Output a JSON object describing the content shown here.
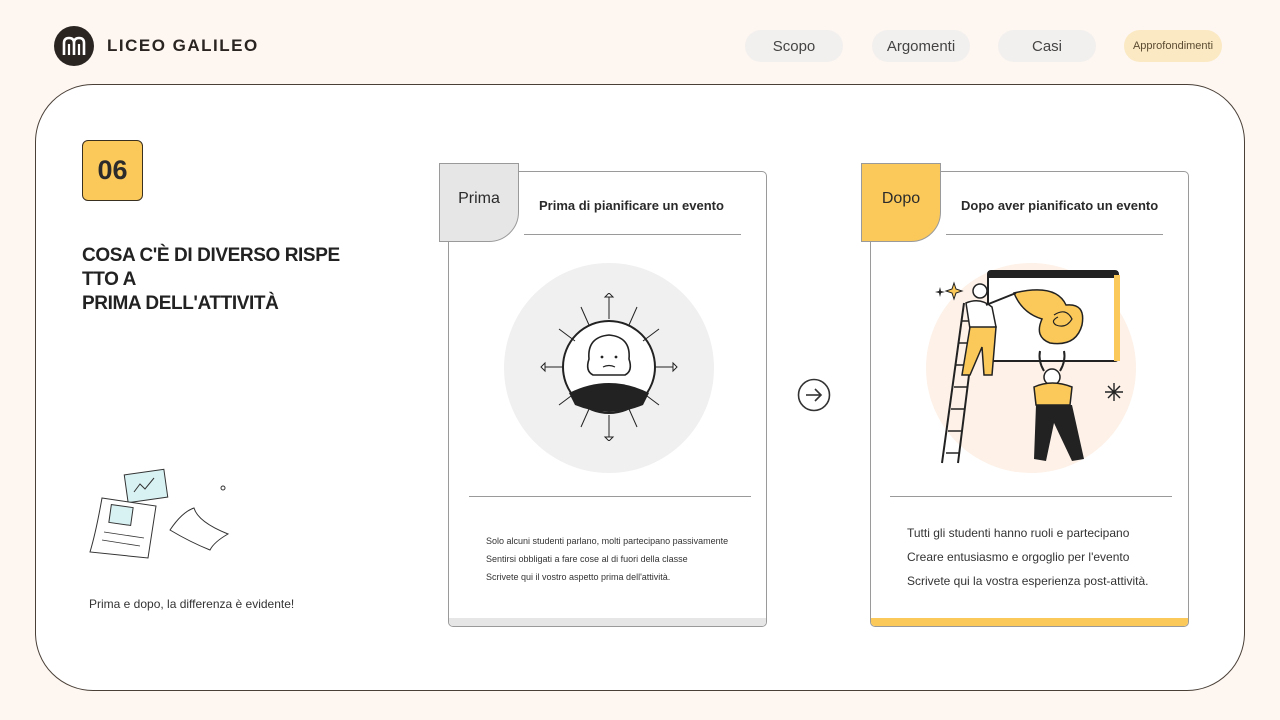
{
  "header": {
    "brand": "LICEO GALILEO",
    "nav": [
      {
        "label": "Scopo"
      },
      {
        "label": "Argomenti"
      },
      {
        "label": "Casi"
      },
      {
        "label": "Approfondimenti"
      }
    ]
  },
  "slide": {
    "number": "06",
    "title_lines": [
      "COSA C'È DI DIVERSO RISPE",
      "TTO A",
      "PRIMA DELL'ATTIVITÀ"
    ],
    "caption": "Prima e dopo, la differenza è evidente!"
  },
  "before": {
    "tab": "Prima",
    "heading": "Prima di pianificare un evento",
    "items": [
      "Solo alcuni studenti parlano, molti partecipano passivamente",
      "Sentirsi obbligati a fare cose al di fuori della classe",
      "Scrivete qui il vostro aspetto prima dell'attività."
    ]
  },
  "after": {
    "tab": "Dopo",
    "heading": "Dopo aver pianificato un evento",
    "items": [
      "Tutti gli studenti hanno ruoli e partecipano",
      "Creare entusiasmo e orgoglio per l'evento",
      "Scrivete qui la vostra esperienza post-attività."
    ]
  },
  "colors": {
    "accent": "#fbc95a",
    "gray_tab": "#e6e6e6",
    "background": "#fdf6f1"
  },
  "icons": [
    "logo-mark-icon",
    "arrow-right-circle-icon",
    "papers-illustration",
    "stressed-person-illustration",
    "teamwork-illustration"
  ]
}
